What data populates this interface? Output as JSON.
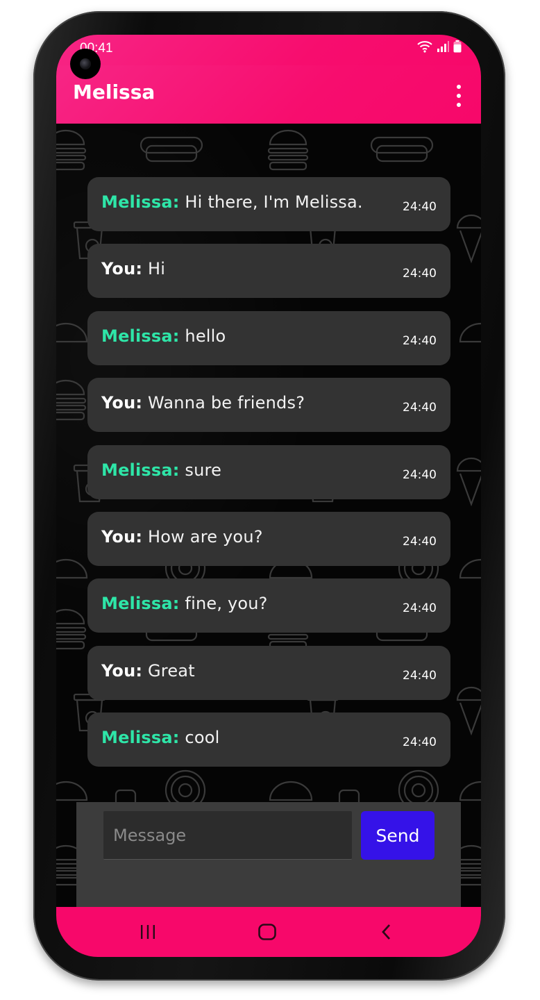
{
  "status_bar": {
    "time": "00:41"
  },
  "app_bar": {
    "title": "Melissa",
    "menu_icon": "more-vert-icon"
  },
  "messages": [
    {
      "sender": "Melissa:",
      "from_me": false,
      "text": "Hi there, I'm Melissa.",
      "time": "24:40"
    },
    {
      "sender": "You:",
      "from_me": true,
      "text": "Hi",
      "time": "24:40"
    },
    {
      "sender": "Melissa:",
      "from_me": false,
      "text": "hello",
      "time": "24:40"
    },
    {
      "sender": "You:",
      "from_me": true,
      "text": "Wanna be friends?",
      "time": "24:40"
    },
    {
      "sender": "Melissa:",
      "from_me": false,
      "text": "sure",
      "time": "24:40"
    },
    {
      "sender": "You:",
      "from_me": true,
      "text": "How are you?",
      "time": "24:40"
    },
    {
      "sender": "Melissa:",
      "from_me": false,
      "text": "fine, you?",
      "time": "24:40"
    },
    {
      "sender": "You:",
      "from_me": true,
      "text": "Great",
      "time": "24:40"
    },
    {
      "sender": "Melissa:",
      "from_me": false,
      "text": "cool",
      "time": "24:40"
    }
  ],
  "composer": {
    "placeholder": "Message",
    "value": "",
    "send_label": "Send"
  },
  "colors": {
    "accent": "#f70d6e",
    "sender_them": "#2ee6a8",
    "send_button": "#3512e8",
    "bubble": "#333333"
  }
}
